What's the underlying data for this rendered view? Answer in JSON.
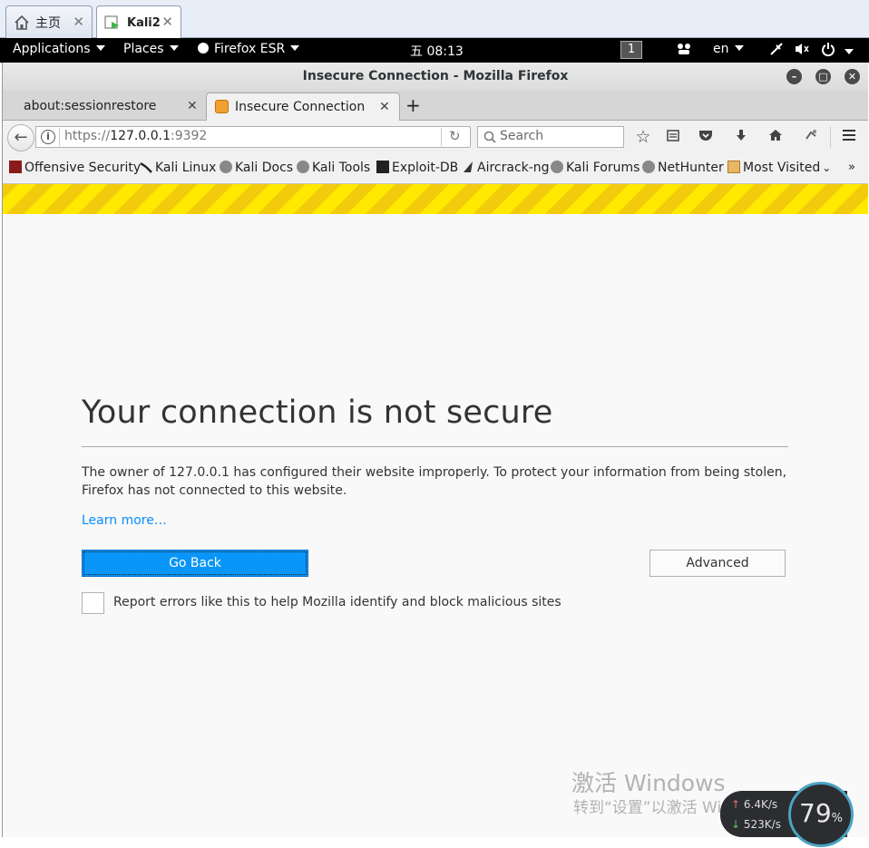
{
  "vm_tabs": [
    {
      "label": "主页",
      "icon": "home-icon"
    },
    {
      "label": "Kali2",
      "icon": "vm-icon"
    }
  ],
  "panel": {
    "applications": "Applications",
    "places": "Places",
    "app_name": "Firefox ESR",
    "clock": "五 08:13",
    "workspace": "1",
    "lang": "en"
  },
  "window": {
    "title": "Insecure Connection - Mozilla Firefox"
  },
  "tabs": [
    {
      "label": "about:sessionrestore"
    },
    {
      "label": "Insecure Connection",
      "icon": "warning-page-icon"
    }
  ],
  "urlbar": {
    "scheme": "https://",
    "host": "127.0.0.1",
    "port": ":9392"
  },
  "search": {
    "placeholder": "Search"
  },
  "bookmarks": [
    {
      "label": "Offensive Security"
    },
    {
      "label": "Kali Linux"
    },
    {
      "label": "Kali Docs"
    },
    {
      "label": "Kali Tools"
    },
    {
      "label": "Exploit-DB"
    },
    {
      "label": "Aircrack-ng"
    },
    {
      "label": "Kali Forums"
    },
    {
      "label": "NetHunter"
    },
    {
      "label": "Most Visited"
    }
  ],
  "error": {
    "title": "Your connection is not secure",
    "description": "The owner of 127.0.0.1 has configured their website improperly. To protect your information from being stolen, Firefox has not connected to this website.",
    "learn_more": "Learn more…",
    "go_back": "Go Back",
    "advanced": "Advanced",
    "report_label": "Report errors like this to help Mozilla identify and block malicious sites"
  },
  "watermark": {
    "line1": "激活 Windows",
    "line2": "转到“设置”以激活 Windows。"
  },
  "net_widget": {
    "upload": "6.4K/s",
    "download": "523K/s",
    "percent": "79",
    "percent_unit": "%"
  },
  "colors": {
    "go_back_bg": "#0996f8",
    "link": "#0a8dff",
    "warning_stripe_a": "#ffe900",
    "warning_stripe_b": "#f2cc0c"
  }
}
